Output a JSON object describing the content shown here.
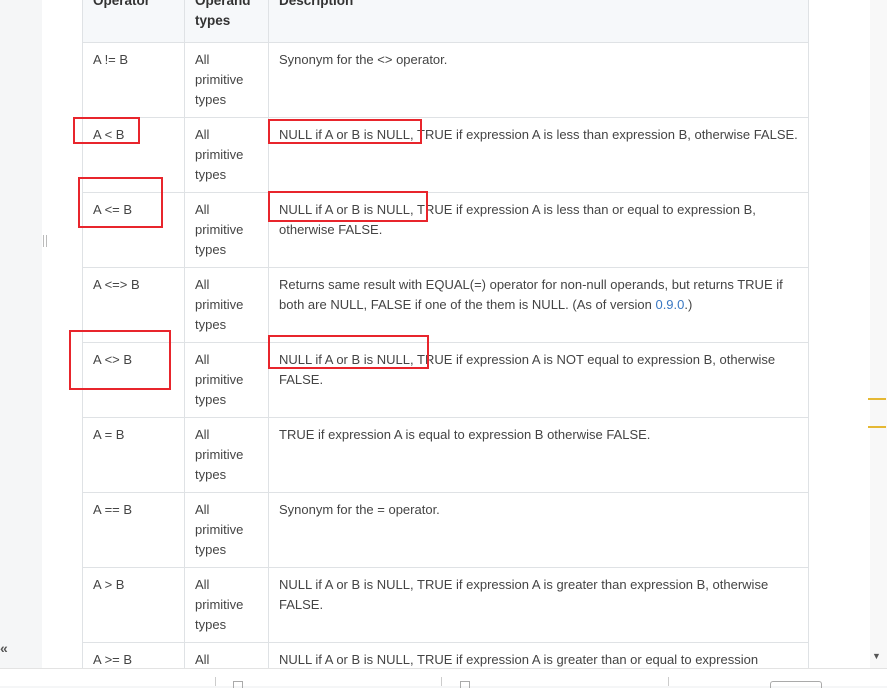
{
  "table": {
    "headers": {
      "operator": "Operator",
      "operand_types": "Operand types",
      "description": "Description"
    },
    "rows": [
      {
        "operator": "A != B",
        "types": "All primitive types",
        "desc": "Synonym for the <> operator."
      },
      {
        "operator": "A < B",
        "types": "All primitive types",
        "desc": "NULL if A or B is NULL, TRUE if expression A is less than expression B, otherwise FALSE."
      },
      {
        "operator": "A <= B",
        "types": "All primitive types",
        "desc": "NULL if A or B is NULL, TRUE if expression A is less than or equal to expression B, otherwise FALSE."
      },
      {
        "operator": "A <=> B",
        "types": "All primitive types",
        "desc": "Returns same result with EQUAL(=) operator for non-null operands, but returns TRUE if both are NULL, FALSE if one of the them is NULL. (As of version ",
        "link": "0.9.0",
        "desc_suffix": ".)"
      },
      {
        "operator": "A <> B",
        "types": "All primitive types",
        "desc": "NULL if A or B is NULL, TRUE if expression A is NOT equal to expression B, otherwise FALSE."
      },
      {
        "operator": "A = B",
        "types": "All primitive types",
        "desc": "TRUE if expression A is equal to expression B otherwise FALSE."
      },
      {
        "operator": "A == B",
        "types": "All primitive types",
        "desc": "Synonym for the = operator."
      },
      {
        "operator": "A > B",
        "types": "All primitive types",
        "desc": "NULL if A or B is NULL, TRUE if expression A is greater than expression B, otherwise FALSE."
      },
      {
        "operator": "A >= B",
        "types": "All",
        "desc": "NULL if A or B is NULL, TRUE if expression A is greater than or equal to expression"
      }
    ]
  },
  "ui": {
    "collapse_glyph": "«",
    "scroll_down_glyph": "▼"
  },
  "colors": {
    "highlight": "#e8252c",
    "link": "#3a78c3",
    "border": "#dfe2e5",
    "header_bg": "#f6f8fa"
  }
}
